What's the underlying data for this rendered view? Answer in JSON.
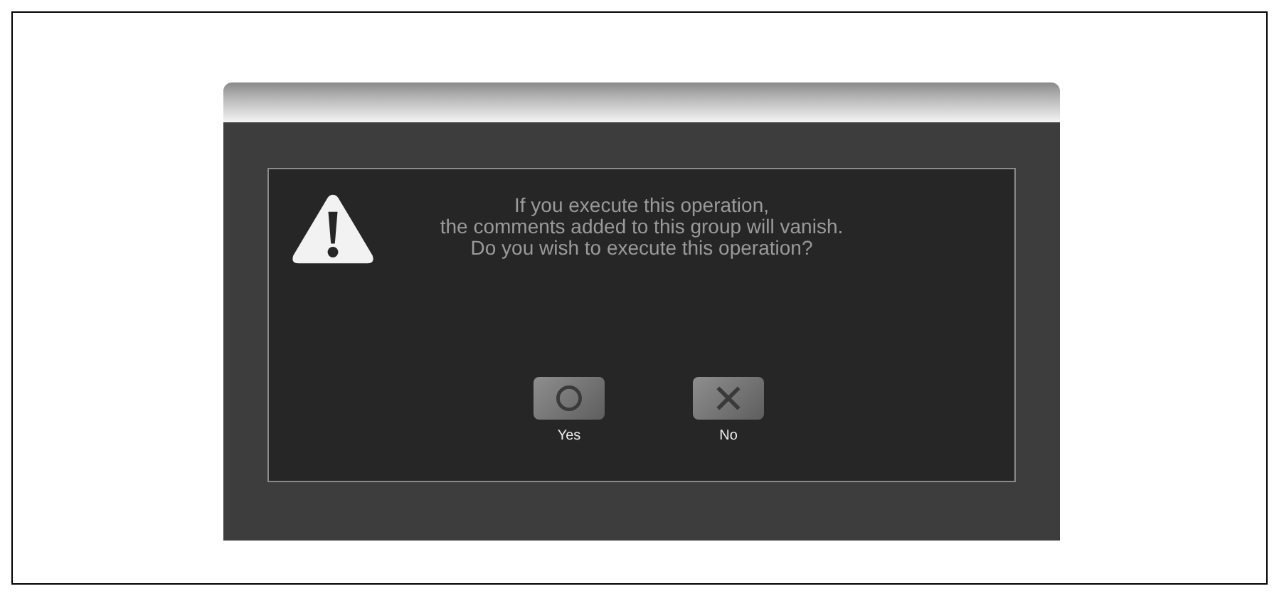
{
  "message": [
    "If you execute this operation,",
    "the comments added to this group will vanish.",
    "Do you wish to execute this operation?"
  ],
  "buttons": [
    {
      "label": "Yes",
      "kind": "circle"
    },
    {
      "label": "No",
      "kind": "cross"
    }
  ]
}
